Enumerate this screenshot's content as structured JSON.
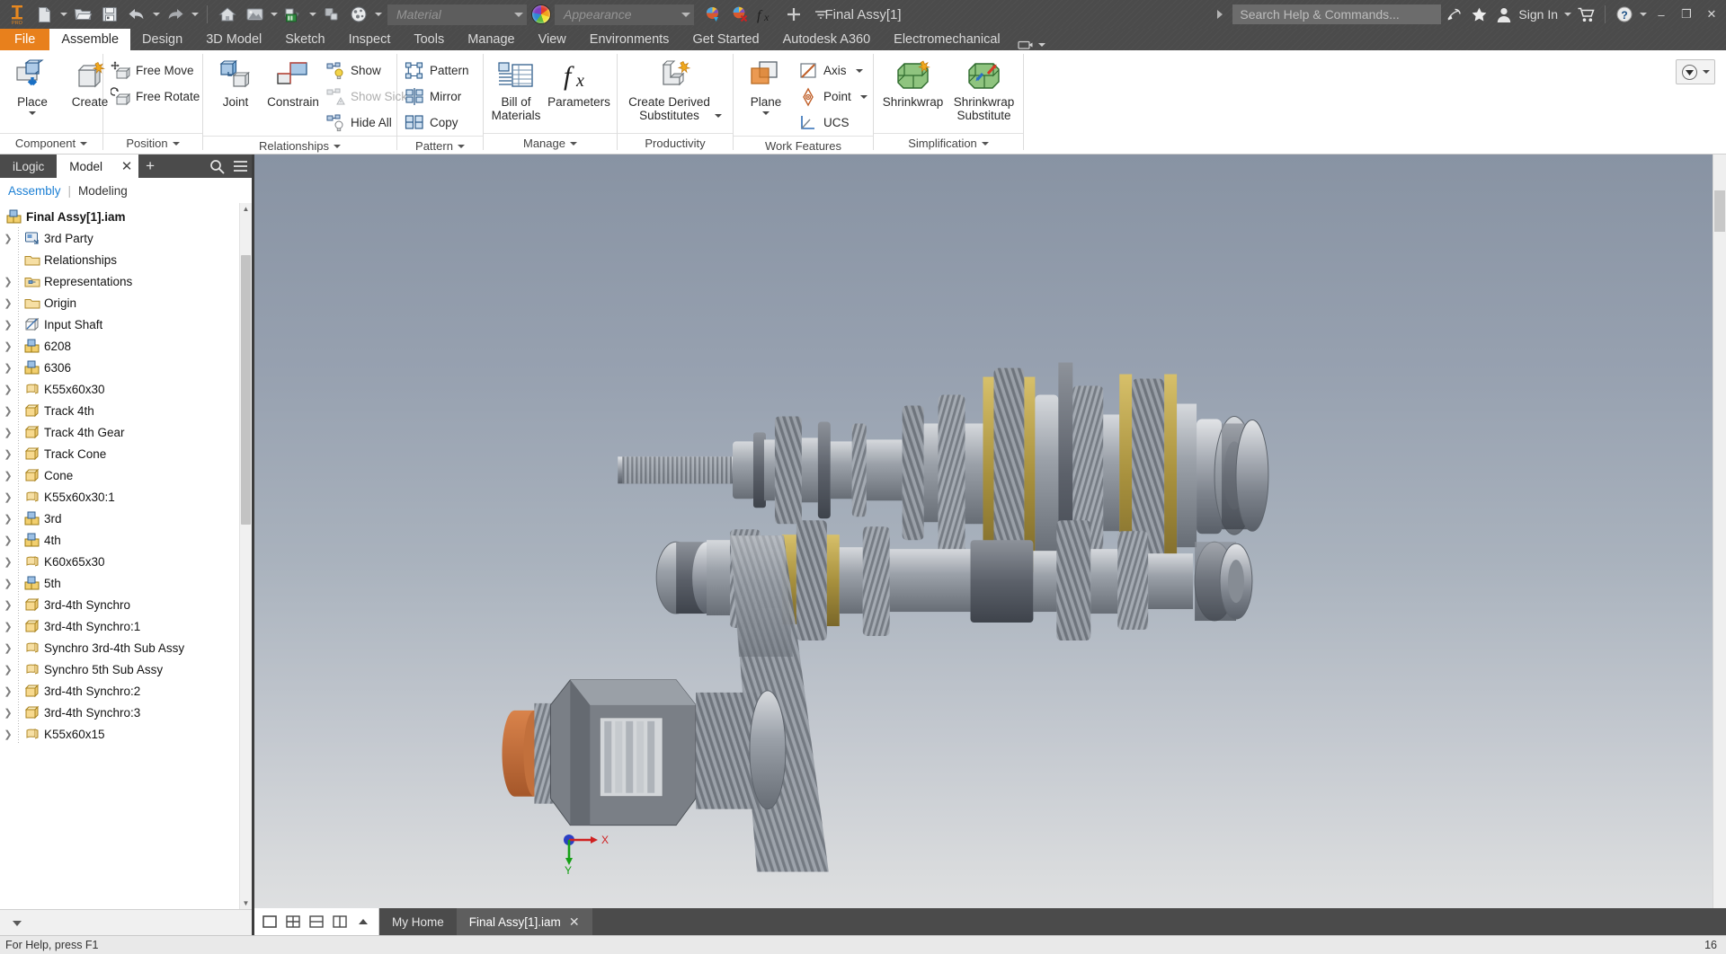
{
  "titlebar": {
    "product_badge": "inventor-pro-logo",
    "document_title": "Final Assy[1]",
    "quick_access": [
      {
        "name": "new-document",
        "icon": "new-file-icon",
        "dropdown": true
      },
      {
        "name": "open-document",
        "icon": "open-folder-icon",
        "dropdown": false
      },
      {
        "name": "save-document",
        "icon": "save-disk-icon",
        "dropdown": false
      },
      {
        "name": "undo",
        "icon": "undo-arrow-icon",
        "dropdown": true
      },
      {
        "name": "redo",
        "icon": "redo-arrow-icon",
        "dropdown": true
      },
      {
        "name": "home-view",
        "icon": "home-icon",
        "dropdown": false
      },
      {
        "name": "display-style",
        "icon": "display-shaded-icon",
        "dropdown": true
      },
      {
        "name": "project",
        "icon": "project-folder-icon",
        "dropdown": true
      },
      {
        "name": "component-select",
        "icon": "component-icon",
        "dropdown": false
      },
      {
        "name": "material-browser",
        "icon": "material-sphere-icon",
        "dropdown": false
      }
    ],
    "material": {
      "value": "",
      "placeholder": "Material"
    },
    "appearance": {
      "value": "",
      "placeholder": "Appearance"
    },
    "right_tools": [
      {
        "name": "adjust-appearance",
        "icon": "appearance-adjust-icon"
      },
      {
        "name": "clear-appearance-override",
        "icon": "appearance-clear-icon"
      },
      {
        "name": "parameters",
        "icon": "fx-icon"
      },
      {
        "name": "add-to-quick-access",
        "icon": "plus-icon"
      },
      {
        "name": "customize-quick-access",
        "icon": "chevron-down-icon"
      }
    ],
    "search": {
      "value": "",
      "placeholder": "Search Help & Commands...",
      "prefix_icon": "chevron-right-icon"
    },
    "account": {
      "share_icon": "share-icon",
      "favorites_icon": "star-icon",
      "user_icon": "person-icon",
      "sign_in_label": "Sign In",
      "sign_in_caret": "chevron-down-icon",
      "cart_icon": "shopping-cart-icon",
      "help_icon": "question-circle-icon",
      "help_caret": "chevron-down-icon"
    },
    "window_controls": {
      "minimize": "–",
      "restore": "❐",
      "close": "✕"
    }
  },
  "tabs": [
    {
      "label": "File",
      "kind": "file"
    },
    {
      "label": "Assemble",
      "kind": "active"
    },
    {
      "label": "Design",
      "kind": "normal"
    },
    {
      "label": "3D Model",
      "kind": "normal"
    },
    {
      "label": "Sketch",
      "kind": "normal"
    },
    {
      "label": "Inspect",
      "kind": "normal"
    },
    {
      "label": "Tools",
      "kind": "normal"
    },
    {
      "label": "Manage",
      "kind": "normal"
    },
    {
      "label": "View",
      "kind": "normal"
    },
    {
      "label": "Environments",
      "kind": "normal"
    },
    {
      "label": "Get Started",
      "kind": "normal"
    },
    {
      "label": "Autodesk A360",
      "kind": "normal"
    },
    {
      "label": "Electromechanical",
      "kind": "normal"
    }
  ],
  "ribbon": {
    "panels": {
      "component": {
        "label": "Component",
        "has_caret": true,
        "place": {
          "label": "Place",
          "icon": "place-component-icon",
          "dropdown": true
        },
        "create": {
          "label": "Create",
          "icon": "create-component-icon"
        }
      },
      "position": {
        "label": "Position",
        "has_caret": true,
        "free_move": {
          "label": "Free Move",
          "icon": "free-move-icon"
        },
        "free_rotate": {
          "label": "Free Rotate",
          "icon": "free-rotate-icon"
        }
      },
      "relationships": {
        "label": "Relationships",
        "has_caret": true,
        "joint": {
          "label": "Joint",
          "icon": "joint-icon"
        },
        "constrain": {
          "label": "Constrain",
          "icon": "constrain-icon"
        },
        "show": {
          "label": "Show",
          "icon": "show-relationships-icon",
          "disabled": false
        },
        "show_sick": {
          "label": "Show Sick",
          "icon": "show-sick-icon",
          "disabled": true
        },
        "hide_all": {
          "label": "Hide All",
          "icon": "hide-all-icon",
          "disabled": false
        }
      },
      "pattern": {
        "label": "Pattern",
        "has_caret": true,
        "pattern": {
          "label": "Pattern",
          "icon": "pattern-icon"
        },
        "mirror": {
          "label": "Mirror",
          "icon": "mirror-icon"
        },
        "copy": {
          "label": "Copy",
          "icon": "copy-icon"
        }
      },
      "manage": {
        "label": "Manage",
        "has_caret": true,
        "bom": {
          "label_line1": "Bill of",
          "label_line2": "Materials",
          "icon": "bill-of-materials-icon"
        },
        "parameters": {
          "label": "Parameters",
          "icon": "fx-parameters-icon"
        }
      },
      "productivity": {
        "label": "Productivity",
        "has_caret": false,
        "derived": {
          "label_line1": "Create Derived",
          "label_line2": "Substitutes",
          "icon": "create-derived-icon",
          "dropdown": true
        }
      },
      "work_features": {
        "label": "Work Features",
        "has_caret": false,
        "plane": {
          "label": "Plane",
          "icon": "work-plane-icon",
          "dropdown": true
        },
        "axis": {
          "label": "Axis",
          "icon": "work-axis-icon",
          "dropdown": true
        },
        "point": {
          "label": "Point",
          "icon": "work-point-icon",
          "dropdown": true
        },
        "ucs": {
          "label": "UCS",
          "icon": "ucs-icon",
          "dropdown": false
        }
      },
      "simplification": {
        "label": "Simplification",
        "has_caret": true,
        "shrinkwrap": {
          "label": "Shrinkwrap",
          "icon": "shrinkwrap-icon"
        },
        "shrinkwrap_substitute": {
          "label_line1": "Shrinkwrap",
          "label_line2": "Substitute",
          "icon": "shrinkwrap-substitute-icon"
        }
      }
    },
    "appearance_button": {
      "icon": "appearance-dropdown-icon",
      "caret": "chevron-down-icon"
    }
  },
  "browser": {
    "tabs": [
      {
        "label": "iLogic",
        "active": false
      },
      {
        "label": "Model",
        "active": true
      }
    ],
    "close_label": "✕",
    "add_label": "+",
    "search_icon": "search-icon",
    "menu_icon": "hamburger-menu-icon",
    "sub_tabs": {
      "active": "Assembly",
      "separator": "|",
      "inactive": "Modeling"
    },
    "root": {
      "label": "Final Assy[1].iam",
      "icon": "assembly-icon"
    },
    "items": [
      {
        "label": "3rd Party",
        "icon": "3rd-party-icon",
        "expandable": true
      },
      {
        "label": "Relationships",
        "icon": "folder-icon",
        "expandable": false
      },
      {
        "label": "Representations",
        "icon": "representations-folder-icon",
        "expandable": true
      },
      {
        "label": "Origin",
        "icon": "folder-icon",
        "expandable": true
      },
      {
        "label": "Input Shaft",
        "icon": "part-sketch-icon",
        "expandable": true
      },
      {
        "label": "6208",
        "icon": "assembly-icon",
        "expandable": true
      },
      {
        "label": "6306",
        "icon": "assembly-icon",
        "expandable": true
      },
      {
        "label": "K55x60x30",
        "icon": "sheet-part-icon",
        "expandable": true
      },
      {
        "label": "Track 4th",
        "icon": "part-icon",
        "expandable": true
      },
      {
        "label": "Track 4th Gear",
        "icon": "part-icon",
        "expandable": true
      },
      {
        "label": "Track Cone",
        "icon": "part-icon",
        "expandable": true
      },
      {
        "label": "Cone",
        "icon": "part-icon",
        "expandable": true
      },
      {
        "label": "K55x60x30:1",
        "icon": "sheet-part-icon",
        "expandable": true
      },
      {
        "label": "3rd",
        "icon": "assembly-icon",
        "expandable": true
      },
      {
        "label": "4th",
        "icon": "assembly-icon",
        "expandable": true
      },
      {
        "label": "K60x65x30",
        "icon": "sheet-part-icon",
        "expandable": true
      },
      {
        "label": "5th",
        "icon": "assembly-icon",
        "expandable": true
      },
      {
        "label": "3rd-4th Synchro",
        "icon": "part-icon",
        "expandable": true
      },
      {
        "label": "3rd-4th Synchro:1",
        "icon": "part-icon",
        "expandable": true
      },
      {
        "label": "Synchro 3rd-4th Sub Assy",
        "icon": "sheet-part-icon",
        "expandable": true
      },
      {
        "label": "Synchro 5th Sub Assy",
        "icon": "sheet-part-icon",
        "expandable": true
      },
      {
        "label": "3rd-4th Synchro:2",
        "icon": "part-icon",
        "expandable": true
      },
      {
        "label": "3rd-4th Synchro:3",
        "icon": "part-icon",
        "expandable": true
      },
      {
        "label": "K55x60x15",
        "icon": "sheet-part-icon",
        "expandable": true
      }
    ]
  },
  "viewport": {
    "triad": {
      "x_label": "X",
      "y_label": "Y",
      "origin_name": "view-triad"
    },
    "model_name": "transmission-gear-assembly"
  },
  "doc_tabs": {
    "view_buttons": [
      {
        "name": "single-view-icon"
      },
      {
        "name": "grid-view-icon"
      },
      {
        "name": "horizontal-split-icon"
      },
      {
        "name": "vertical-split-icon"
      },
      {
        "name": "expand-views-icon"
      }
    ],
    "tabs": [
      {
        "label": "My Home",
        "active": false,
        "closable": false
      },
      {
        "label": "Final Assy[1].iam",
        "active": true,
        "closable": true,
        "close_label": "✕"
      }
    ]
  },
  "statusbar": {
    "message": "For Help, press F1",
    "right": "16"
  },
  "colors": {
    "accent_orange": "#e8801c",
    "chrome_dark": "#4b4b4b",
    "ribbon_bg": "#ffffff",
    "link_blue": "#1b7fd4",
    "viewport_top": "#8893a3",
    "viewport_bottom": "#e2e3e4"
  }
}
